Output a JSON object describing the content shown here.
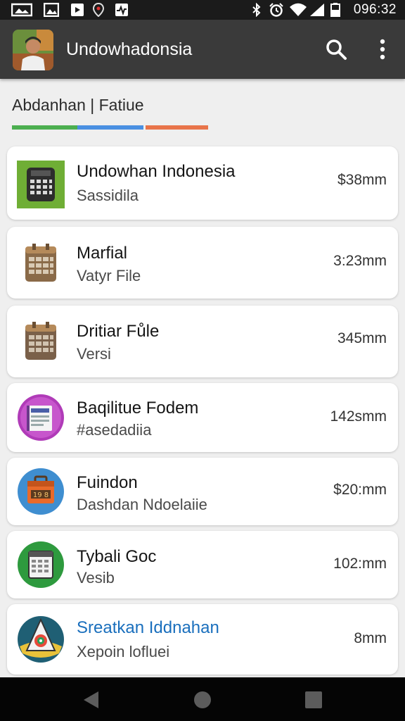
{
  "status_bar": {
    "time": "096:32"
  },
  "app_bar": {
    "title": "Undowhadonsia"
  },
  "section": {
    "title": "Abdanhan | Fatiue"
  },
  "colors": {
    "tab_green": "#4caf50",
    "tab_blue": "#4a90e2",
    "tab_orange": "#e8744a",
    "link_blue": "#1a6fbd"
  },
  "items": [
    {
      "title": "Undowhan Indonesia",
      "subtitle": "Sassidila",
      "time": "$38mm",
      "icon": "calculator-icon"
    },
    {
      "title": "Marfial",
      "subtitle": "Vatyr File",
      "time": "3:23mm",
      "icon": "calendar-icon"
    },
    {
      "title": "Dritiar Fůle",
      "subtitle": "Versi",
      "time": "345mm",
      "icon": "calendar-icon"
    },
    {
      "title": "Baqilitue Fodem",
      "subtitle": "#asedadiia",
      "time": "142smm",
      "icon": "document-icon"
    },
    {
      "title": "Fuindon",
      "subtitle": "Dashdan Ndoelaiie",
      "time": "$20:mm",
      "icon": "briefcase-icon"
    },
    {
      "title": "Tybali Goc",
      "subtitle": "Vesib",
      "time": "102:mm",
      "icon": "calendar-icon"
    },
    {
      "title": "Sreatkan Iddnahan",
      "subtitle": "Xepoin lofluei",
      "time": "8mm",
      "icon": "map-logo-icon"
    }
  ]
}
